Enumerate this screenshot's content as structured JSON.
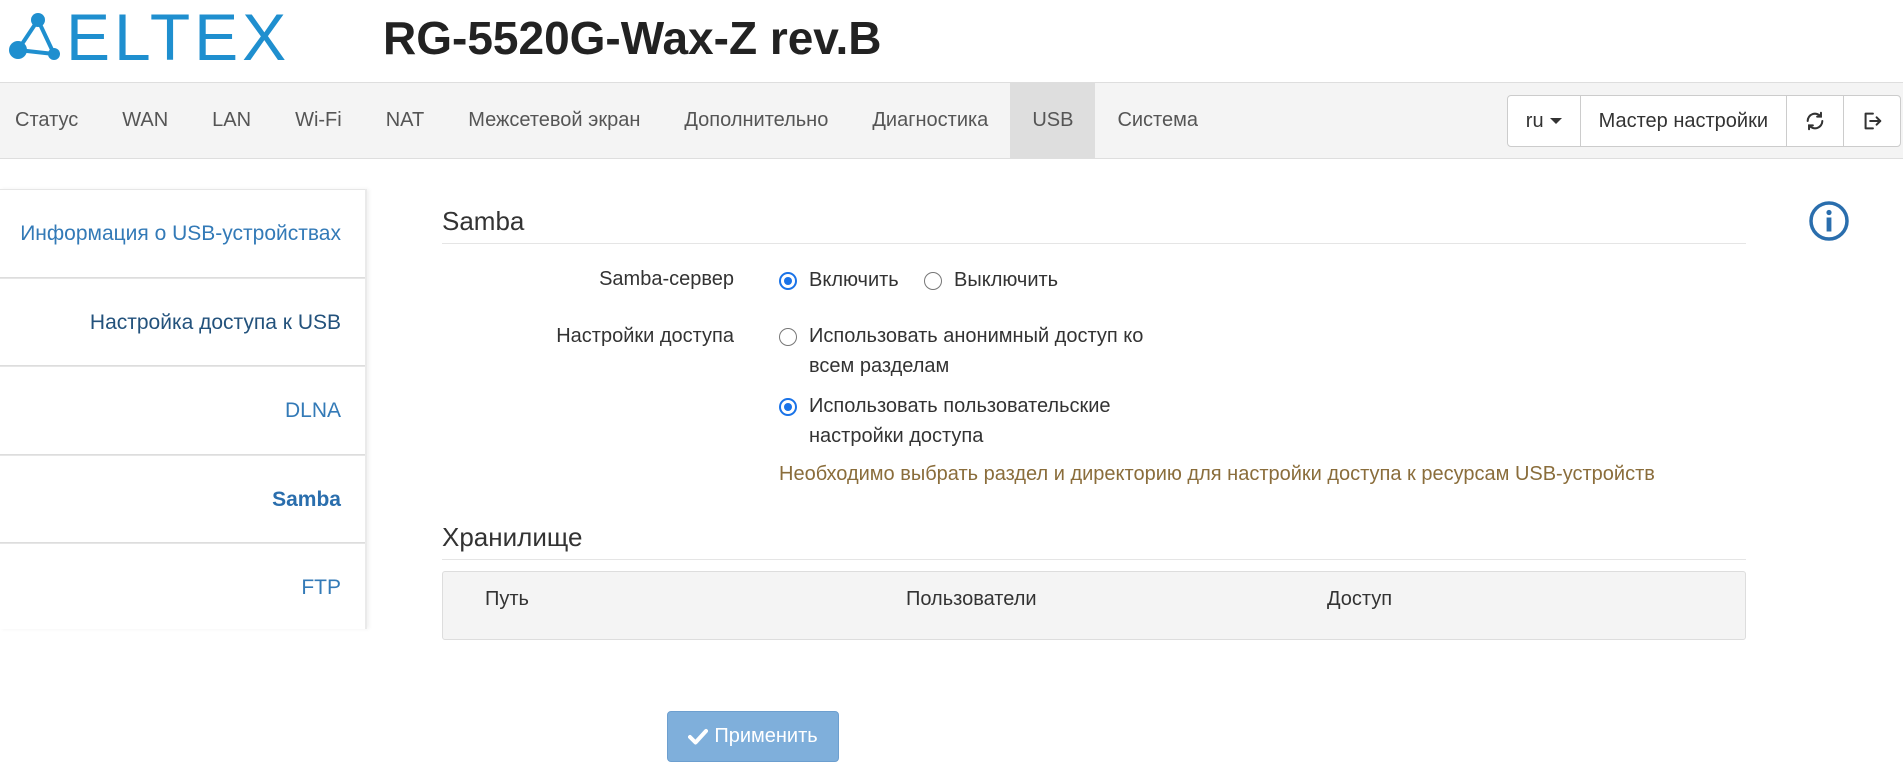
{
  "header": {
    "logo_text": "ELTEX",
    "model": "RG-5520G-Wax-Z rev.B"
  },
  "nav": {
    "tabs": [
      "Статус",
      "WAN",
      "LAN",
      "Wi-Fi",
      "NAT",
      "Межсетевой экран",
      "Дополнительно",
      "Диагностика",
      "USB",
      "Система"
    ],
    "active_tab": "USB",
    "language": "ru",
    "wizard_label": "Мастер настройки",
    "refresh_icon": "refresh-icon",
    "logout_icon": "logout-icon"
  },
  "sidebar": {
    "items": [
      {
        "label": "Информация о USB-устройствах"
      },
      {
        "label": "Настройка доступа к USB"
      },
      {
        "label": "DLNA"
      },
      {
        "label": "Samba"
      },
      {
        "label": "FTP"
      }
    ],
    "active_item": "Samba"
  },
  "samba": {
    "title": "Samba",
    "server_label": "Samba-сервер",
    "enable_label": "Включить",
    "disable_label": "Выключить",
    "server_enabled": true,
    "access_label": "Настройки доступа",
    "anon_line1": "Использовать анонимный доступ ко",
    "anon_line2": "всем разделам",
    "user_line1": "Использовать пользовательские",
    "user_line2": "настройки доступа",
    "access_mode": "user",
    "hint": "Необходимо выбрать раздел и директорию для настройки доступа к ресурсам USB-устройств"
  },
  "storage": {
    "title": "Хранилище",
    "columns": [
      "Путь",
      "Пользователи",
      "Доступ"
    ]
  },
  "apply_label": "Применить",
  "colors": {
    "brand": "#1f8fcf",
    "link": "#337ab7",
    "radio": "#1a73e8",
    "hint": "#8a6d3b",
    "apply": "#7fafdb"
  }
}
